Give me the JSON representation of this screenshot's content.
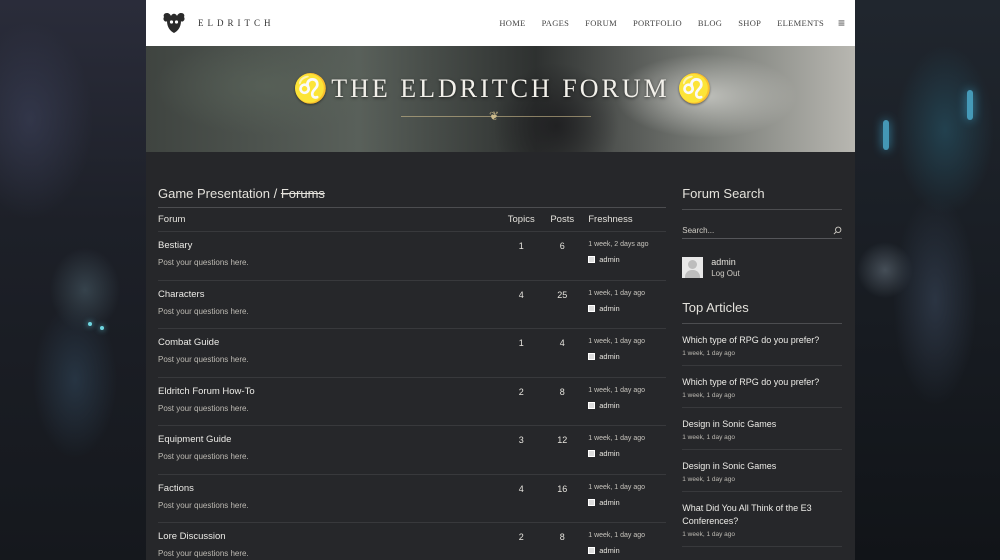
{
  "site": {
    "logo_text": "ELDRITCH",
    "nav": [
      "HOME",
      "PAGES",
      "FORUM",
      "PORTFOLIO",
      "BLOG",
      "SHOP",
      "ELEMENTS"
    ],
    "menu_icon": "hamburger-icon"
  },
  "banner": {
    "title": "THE ELDRITCH FORUM"
  },
  "breadcrumb": {
    "section": "Game Presentation",
    "separator": " / ",
    "link": "Forums"
  },
  "table": {
    "headers": {
      "forum": "Forum",
      "topics": "Topics",
      "posts": "Posts",
      "freshness": "Freshness"
    },
    "rows": [
      {
        "title": "Bestiary",
        "desc": "Post your questions here.",
        "topics": "1",
        "posts": "6",
        "time": "1 week, 2 days ago",
        "user": "admin"
      },
      {
        "title": "Characters",
        "desc": "Post your questions here.",
        "topics": "4",
        "posts": "25",
        "time": "1 week, 1 day ago",
        "user": "admin"
      },
      {
        "title": "Combat Guide",
        "desc": "Post your questions here.",
        "topics": "1",
        "posts": "4",
        "time": "1 week, 1 day ago",
        "user": "admin"
      },
      {
        "title": "Eldritch Forum How-To",
        "desc": "Post your questions here.",
        "topics": "2",
        "posts": "8",
        "time": "1 week, 1 day ago",
        "user": "admin"
      },
      {
        "title": "Equipment Guide",
        "desc": "Post your questions here.",
        "topics": "3",
        "posts": "12",
        "time": "1 week, 1 day ago",
        "user": "admin"
      },
      {
        "title": "Factions",
        "desc": "Post your questions here.",
        "topics": "4",
        "posts": "16",
        "time": "1 week, 1 day ago",
        "user": "admin"
      },
      {
        "title": "Lore Discussion",
        "desc": "Post your questions here.",
        "topics": "2",
        "posts": "8",
        "time": "1 week, 1 day ago",
        "user": "admin"
      }
    ]
  },
  "sidebar": {
    "search_title": "Forum Search",
    "search_placeholder": "Search...",
    "user": {
      "name": "admin",
      "logout": "Log Out"
    },
    "top_title": "Top Articles",
    "articles": [
      {
        "title": "Which type of RPG do you prefer?",
        "time": "1 week, 1 day ago"
      },
      {
        "title": "Which type of RPG do you prefer?",
        "time": "1 week, 1 day ago"
      },
      {
        "title": "Design in Sonic Games",
        "time": "1 week, 1 day ago"
      },
      {
        "title": "Design in Sonic Games",
        "time": "1 week, 1 day ago"
      },
      {
        "title": "What Did You All Think of the E3 Conferences?",
        "time": "1 week, 1 day ago"
      }
    ]
  }
}
